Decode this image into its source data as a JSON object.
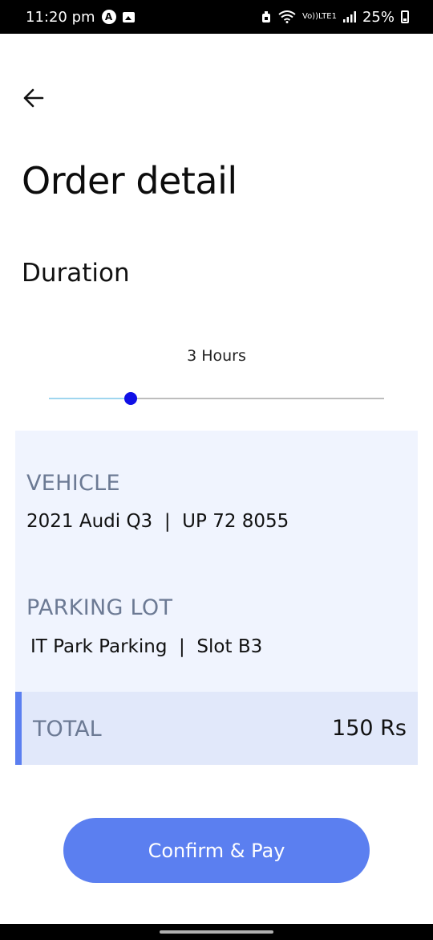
{
  "status_bar": {
    "time": "11:20 pm",
    "network_top": "Vo))",
    "network_bottom": "LTE1",
    "battery": "25%"
  },
  "header": {
    "back_icon": "arrow-left-icon",
    "title": "Order detail"
  },
  "duration": {
    "label": "Duration",
    "value_text": "3 Hours",
    "slider_fraction": 0.245
  },
  "details": {
    "vehicle_heading": "VEHICLE",
    "vehicle_value": "2021 Audi Q3  |  UP 72 8055",
    "parking_heading": "PARKING LOT",
    "parking_value": "IT Park Parking  |  Slot B3",
    "total_label": "TOTAL",
    "total_amount": "150 Rs"
  },
  "actions": {
    "confirm_label": "Confirm & Pay"
  },
  "colors": {
    "accent": "#5b7ff0",
    "card_bg": "#f0f4fe",
    "total_bg": "#e1e8fa",
    "slider_thumb": "#1010e6"
  }
}
